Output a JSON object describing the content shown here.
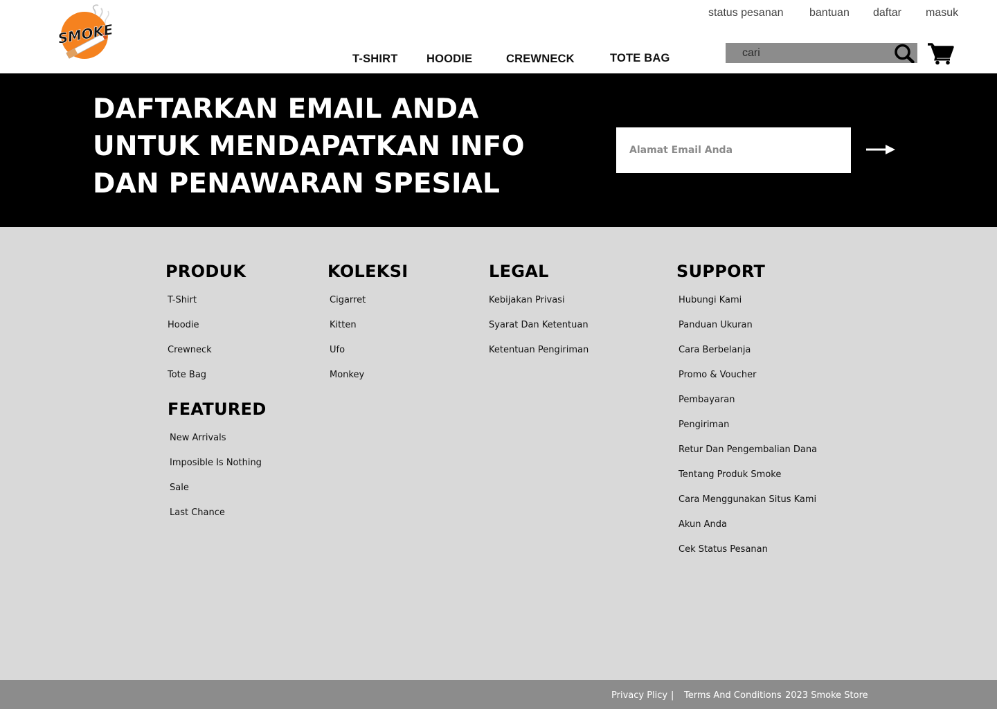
{
  "brand": {
    "logo_text": "SMOKE",
    "colors": {
      "logo_orange": "#f5821f",
      "logo_black": "#000000"
    }
  },
  "top_links": [
    "status pesanan",
    "bantuan",
    "daftar",
    "masuk"
  ],
  "nav": [
    "T-SHIRT",
    "HOODIE",
    "CREWNECK",
    "TOTE BAG"
  ],
  "search": {
    "placeholder": "cari",
    "icon": "search-icon"
  },
  "cart": {
    "icon": "cart-icon"
  },
  "newsletter": {
    "lines": [
      "DAFTARKAN EMAIL ANDA",
      "UNTUK MENDAPATKAN INFO",
      "DAN PENAWARAN SPESIAL"
    ],
    "email_placeholder": "Alamat Email Anda",
    "submit_icon": "arrow-right-icon"
  },
  "footer": {
    "produk": {
      "title": "PRODUK",
      "items": [
        "T-Shirt",
        "Hoodie",
        "Crewneck",
        "Tote Bag"
      ]
    },
    "featured": {
      "title": "FEATURED",
      "items": [
        "New Arrivals",
        "Imposible Is Nothing",
        "Sale",
        "Last Chance"
      ]
    },
    "koleksi": {
      "title": "KOLEKSI",
      "items": [
        "Cigarret",
        "Kitten",
        "Ufo",
        "Monkey"
      ]
    },
    "legal": {
      "title": "LEGAL",
      "items": [
        "Kebijakan Privasi",
        "Syarat Dan Ketentuan",
        "Ketentuan Pengiriman"
      ]
    },
    "support": {
      "title": "SUPPORT",
      "items": [
        "Hubungi Kami",
        "Panduan Ukuran",
        "Cara Berbelanja",
        "Promo & Voucher",
        "Pembayaran",
        "Pengiriman",
        "Retur Dan Pengembalian Dana",
        "Tentang Produk Smoke",
        "Cara Menggunakan Situs Kami",
        "Akun Anda",
        "Cek Status Pesanan"
      ]
    }
  },
  "bottom_bar": {
    "privacy": "Privacy Plicy",
    "separator": "|",
    "terms": "Terms And Conditions",
    "copyright": "2023 Smoke Store"
  }
}
